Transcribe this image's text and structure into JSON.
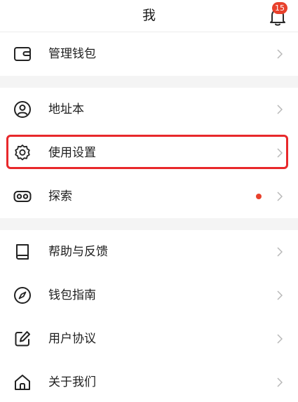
{
  "header": {
    "title": "我",
    "notification_count": "15"
  },
  "sections": [
    {
      "items": [
        {
          "label": "管理钱包",
          "icon": "wallet-icon"
        }
      ]
    },
    {
      "items": [
        {
          "label": "地址本",
          "icon": "user-circle-icon"
        },
        {
          "label": "使用设置",
          "icon": "gear-icon"
        },
        {
          "label": "探索",
          "icon": "vr-goggles-icon",
          "has_dot": true
        }
      ]
    },
    {
      "items": [
        {
          "label": "帮助与反馈",
          "icon": "book-icon"
        },
        {
          "label": "钱包指南",
          "icon": "compass-icon"
        },
        {
          "label": "用户协议",
          "icon": "edit-icon"
        },
        {
          "label": "关于我们",
          "icon": "home-icon"
        }
      ]
    }
  ],
  "colors": {
    "accent_red": "#e8412c",
    "highlight_border": "#e8282b",
    "section_gap": "#f4f4f4"
  }
}
